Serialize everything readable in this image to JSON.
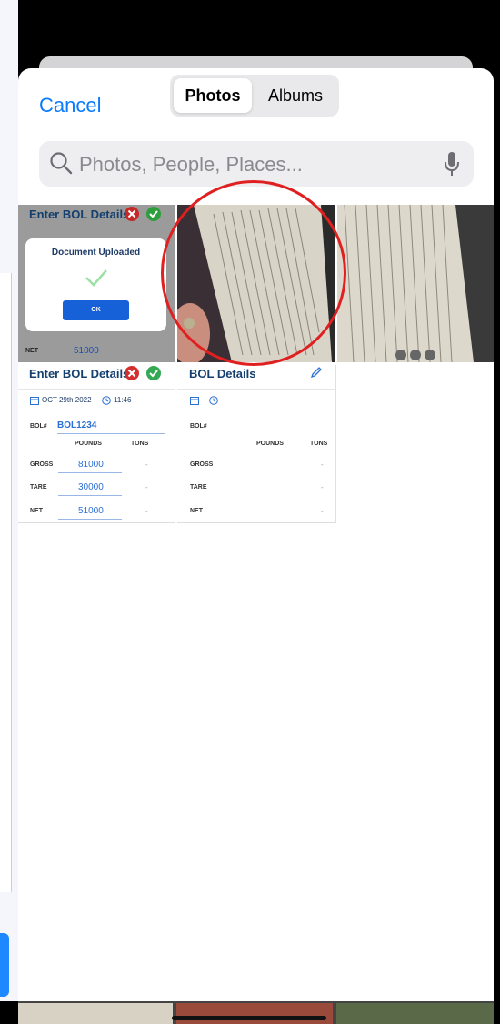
{
  "picker": {
    "cancel_label": "Cancel",
    "tabs": [
      {
        "label": "Photos",
        "selected": true
      },
      {
        "label": "Albums",
        "selected": false
      }
    ],
    "search_placeholder": "Photos, People, Places..."
  },
  "thumbnails": {
    "enter_bol": {
      "title": "Enter BOL Details",
      "dialog_title": "Document Uploaded",
      "ok_label": "OK",
      "net_label": "NET",
      "net_value": "51000",
      "dash": "-"
    },
    "enter_bol_form": {
      "title": "Enter BOL Details",
      "date": "OCT 29th 2022",
      "time": "11:46",
      "bol_label": "BOL#",
      "bol_value": "BOL1234",
      "pounds_header": "POUNDS",
      "tons_header": "TONS",
      "rows": [
        {
          "label": "GROSS",
          "value": "81000",
          "tons": "-"
        },
        {
          "label": "TARE",
          "value": "30000",
          "tons": "-"
        },
        {
          "label": "NET",
          "value": "51000",
          "tons": "-"
        }
      ]
    },
    "bol_form_empty": {
      "title": "BOL Details",
      "bol_label": "BOL#",
      "pounds_header": "POUNDS",
      "tons_header": "TONS",
      "rows": [
        {
          "label": "GROSS",
          "tons": "-"
        },
        {
          "label": "TARE",
          "tons": "-"
        },
        {
          "label": "NET",
          "tons": "-"
        }
      ]
    }
  },
  "colors": {
    "accent": "#0a7aff",
    "annotation_circle": "#e02020",
    "form_value": "#2c6fd6"
  }
}
